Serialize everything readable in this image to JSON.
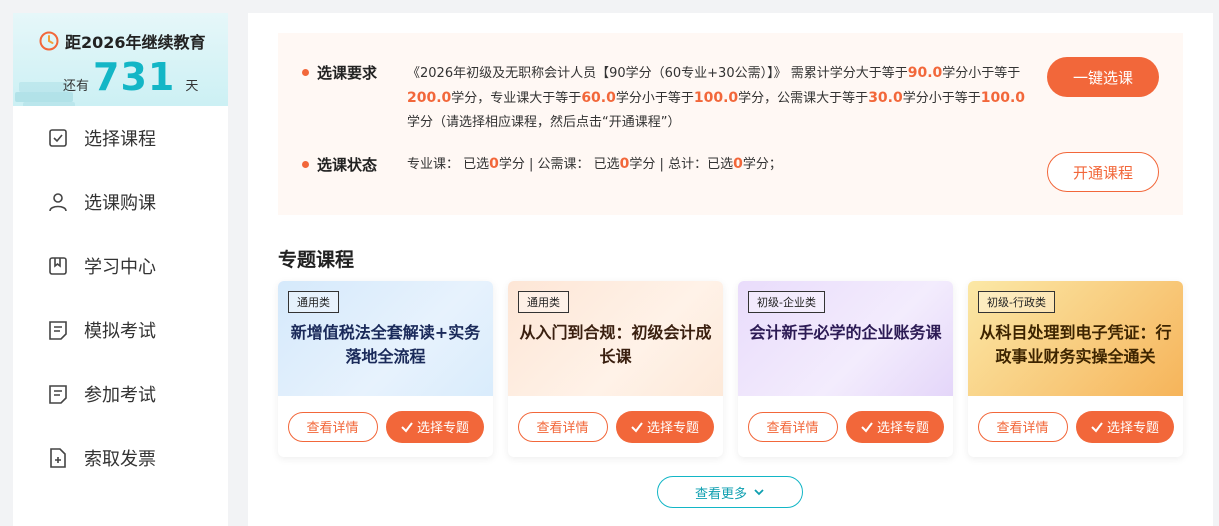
{
  "colors": {
    "accent": "#f2673a",
    "teal": "#13b6c6"
  },
  "countdown": {
    "title": "距2026年继续教育",
    "prefix": "还有",
    "days": "731",
    "suffix": "天"
  },
  "menu": [
    {
      "label": "选择课程",
      "icon": "checklist-icon"
    },
    {
      "label": "选课购课",
      "icon": "user-icon"
    },
    {
      "label": "学习中心",
      "icon": "bookmark-icon"
    },
    {
      "label": "模拟考试",
      "icon": "note-icon"
    },
    {
      "label": "参加考试",
      "icon": "note-icon"
    },
    {
      "label": "索取发票",
      "icon": "file-add-icon"
    }
  ],
  "requirements": {
    "label": "选课要求",
    "text_parts": [
      "《2026年初级及无职称会计人员【90学分（60专业+30公需）】》 需累计学分大于等于",
      "90.0",
      "学分小于等于",
      "200.0",
      "学分，专业课大于等于",
      "60.0",
      "学分小于等于",
      "100.0",
      "学分，公需课大于等于",
      "30.0",
      "学分小于等于",
      "100.0",
      "学分（请选择相应课程，然后点击“开通课程”）"
    ],
    "button": "一键选课"
  },
  "status": {
    "label": "选课状态",
    "pro_label": "专业课：  已选",
    "pro_value": "0",
    "pro_unit": "学分 | 公需课：  已选",
    "pub_value": "0",
    "pub_unit": "学分 | 总计：已选",
    "total_value": "0",
    "total_unit": "学分；",
    "button": "开通课程"
  },
  "section_title": "专题课程",
  "cards": [
    {
      "tag": "通用类",
      "title": "新增值税法全套解读+实务落地全流程"
    },
    {
      "tag": "通用类",
      "title": "从入门到合规：初级会计成长课"
    },
    {
      "tag": "初级-企业类",
      "title": "会计新手必学的企业账务课"
    },
    {
      "tag": "初级-行政类",
      "title": "从科目处理到电子凭证：行政事业财务实操全通关"
    }
  ],
  "card_buttons": {
    "detail": "查看详情",
    "select": "选择专题"
  },
  "more_button": "查看更多"
}
